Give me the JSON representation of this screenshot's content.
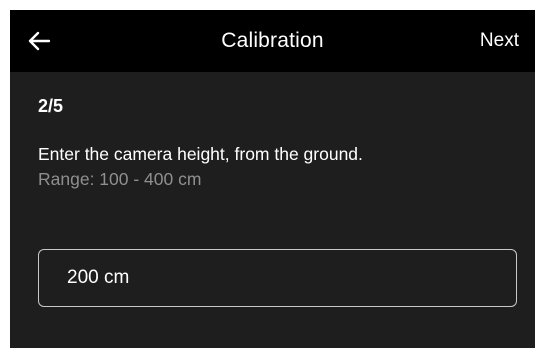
{
  "header": {
    "title": "Calibration",
    "next_label": "Next",
    "back_icon": "arrow-left-icon"
  },
  "content": {
    "step": "2/5",
    "instruction": "Enter the camera height, from the ground.",
    "range": "Range: 100 - 400 cm"
  },
  "height_input": {
    "value": "200 cm"
  },
  "colors": {
    "topbar": "#000000",
    "background": "#1e1e1e",
    "text": "#ffffff",
    "muted_text": "#8f8f8f",
    "input_border": "#c8c8c8"
  }
}
